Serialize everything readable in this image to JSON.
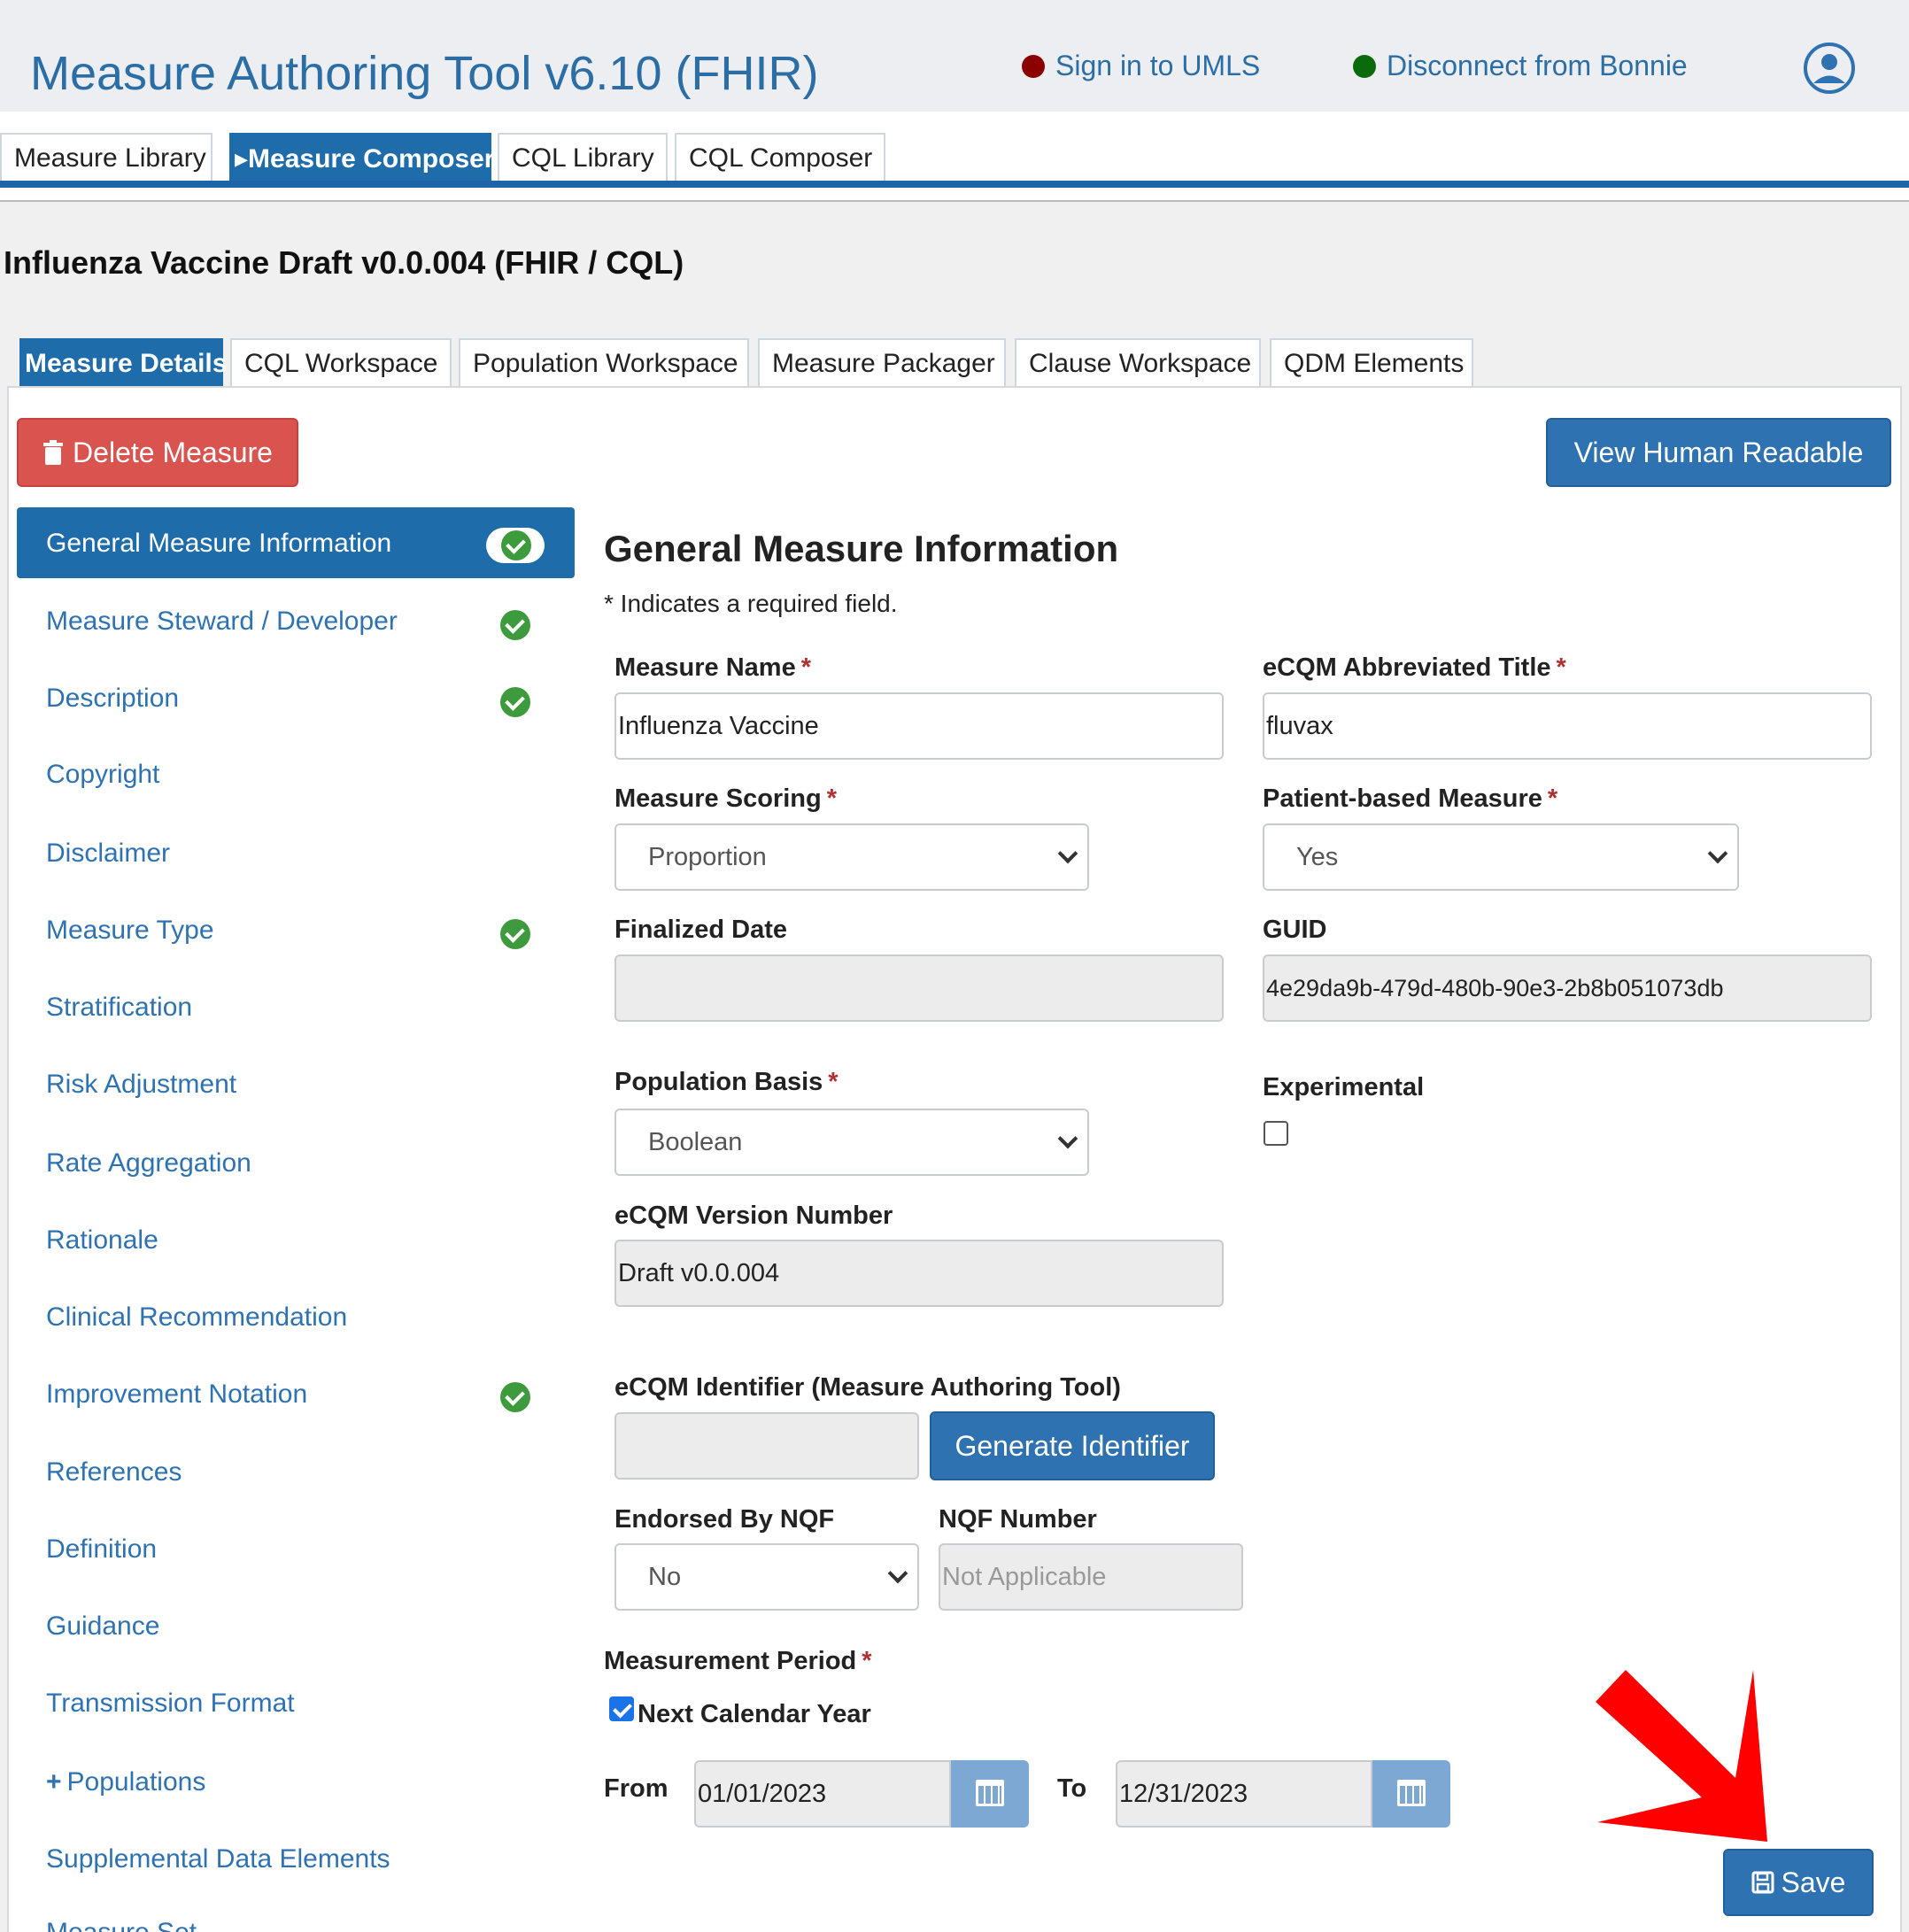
{
  "app": {
    "title": "Measure Authoring Tool v6.10 (FHIR)",
    "umls_link": "Sign in to UMLS",
    "umls_status_color": "#8b0000",
    "bonnie_link": "Disconnect from Bonnie",
    "bonnie_status_color": "#0a6b0a",
    "profile_icon": "user-circle-icon"
  },
  "main_tabs": [
    {
      "label": "Measure Library",
      "active": false
    },
    {
      "label": "▸Measure Composer",
      "active": true
    },
    {
      "label": "CQL Library",
      "active": false
    },
    {
      "label": "CQL Composer",
      "active": false
    }
  ],
  "measure_title": "Influenza Vaccine Draft v0.0.004 (FHIR / CQL)",
  "sub_tabs": [
    {
      "label": "Measure Details",
      "active": true
    },
    {
      "label": "CQL Workspace",
      "active": false
    },
    {
      "label": "Population Workspace",
      "active": false
    },
    {
      "label": "Measure Packager",
      "active": false
    },
    {
      "label": "Clause Workspace",
      "active": false
    },
    {
      "label": "QDM Elements",
      "active": false
    }
  ],
  "buttons": {
    "delete_measure": "Delete Measure",
    "view_human_readable": "View Human Readable",
    "generate_identifier": "Generate Identifier",
    "save": "Save"
  },
  "sidebar": {
    "items": [
      {
        "label": "General Measure Information",
        "complete": true,
        "active": true
      },
      {
        "label": "Measure Steward / Developer",
        "complete": true
      },
      {
        "label": "Description",
        "complete": true
      },
      {
        "label": "Copyright",
        "complete": false
      },
      {
        "label": "Disclaimer",
        "complete": false
      },
      {
        "label": "Measure Type",
        "complete": true
      },
      {
        "label": "Stratification",
        "complete": false
      },
      {
        "label": "Risk Adjustment",
        "complete": false
      },
      {
        "label": "Rate Aggregation",
        "complete": false
      },
      {
        "label": "Rationale",
        "complete": false
      },
      {
        "label": "Clinical Recommendation",
        "complete": false
      },
      {
        "label": "Improvement Notation",
        "complete": true
      },
      {
        "label": "References",
        "complete": false
      },
      {
        "label": "Definition",
        "complete": false
      },
      {
        "label": "Guidance",
        "complete": false
      },
      {
        "label": "Transmission Format",
        "complete": false
      },
      {
        "label": "Populations",
        "complete": false,
        "expandable": true
      },
      {
        "label": "Supplemental Data Elements",
        "complete": false
      },
      {
        "label": "Measure Set",
        "complete": false
      }
    ]
  },
  "form": {
    "heading": "General Measure Information",
    "required_note": "* Indicates a required field.",
    "required_marker": "*",
    "measure_name": {
      "label": "Measure Name",
      "value": "Influenza Vaccine"
    },
    "abbrev_title": {
      "label": "eCQM Abbreviated Title",
      "value": "fluvax"
    },
    "measure_scoring": {
      "label": "Measure Scoring",
      "value": "Proportion"
    },
    "patient_based": {
      "label": "Patient-based Measure",
      "value": "Yes"
    },
    "finalized_date": {
      "label": "Finalized Date",
      "value": ""
    },
    "guid": {
      "label": "GUID",
      "value": "4e29da9b-479d-480b-90e3-2b8b051073db"
    },
    "population_basis": {
      "label": "Population Basis",
      "value": "Boolean"
    },
    "experimental": {
      "label": "Experimental",
      "checked": false
    },
    "version_number": {
      "label": "eCQM Version Number",
      "value": "Draft v0.0.004"
    },
    "identifier": {
      "label": "eCQM Identifier (Measure Authoring Tool)",
      "value": ""
    },
    "endorsed_by_nqf": {
      "label": "Endorsed By NQF",
      "value": "No"
    },
    "nqf_number": {
      "label": "NQF Number",
      "placeholder": "Not Applicable"
    },
    "measurement_period": {
      "label": "Measurement Period",
      "next_calendar_year_label": "Next Calendar Year",
      "next_calendar_year_checked": true,
      "from_label": "From",
      "from_value": "01/01/2023",
      "to_label": "To",
      "to_value": "12/31/2023"
    }
  },
  "annotation": {
    "arrow_color": "#ff0000"
  }
}
